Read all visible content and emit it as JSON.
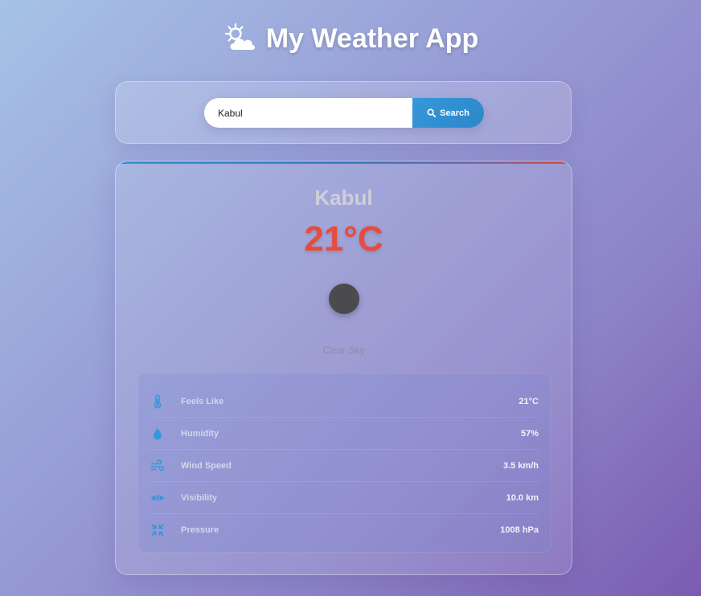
{
  "app": {
    "title": "My Weather App",
    "title_icon": "sun-behind-cloud-icon"
  },
  "search": {
    "value": "Kabul",
    "button_label": "Search",
    "button_icon": "search-icon"
  },
  "weather": {
    "city": "Kabul",
    "temperature": "21°C",
    "icon": "weather-condition-icon",
    "description": "Clear Sky",
    "details": [
      {
        "label": "Feels Like",
        "value": "21°C",
        "icon": "thermometer-icon"
      },
      {
        "label": "Humidity",
        "value": "57%",
        "icon": "water-drop-icon"
      },
      {
        "label": "Wind Speed",
        "value": "3.5 km/h",
        "icon": "wind-icon"
      },
      {
        "label": "Visibility",
        "value": "10.0 km",
        "icon": "eye-icon"
      },
      {
        "label": "Pressure",
        "value": "1008 hPa",
        "icon": "compress-arrows-icon"
      }
    ]
  },
  "colors": {
    "accent": "#3498db",
    "temperature": "#e74c3c",
    "background_start": "#a6c2e6",
    "background_end": "#7b5cb1"
  }
}
